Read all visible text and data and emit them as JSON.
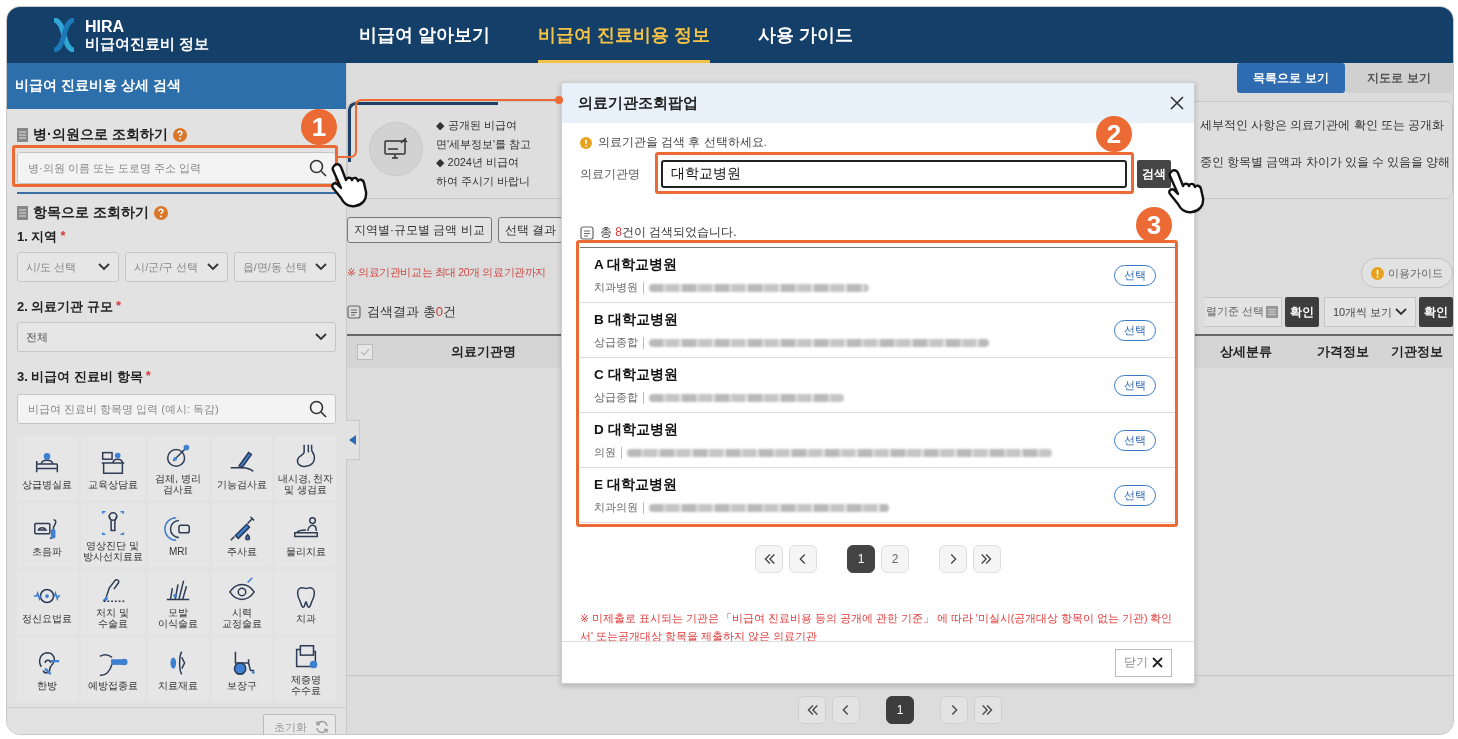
{
  "header": {
    "logo_title": "HIRA",
    "logo_subtitle": "비급여진료비 정보",
    "nav": [
      {
        "label": "비급여 알아보기",
        "selected": false
      },
      {
        "label": "비급여 진료비용 정보",
        "selected": true
      },
      {
        "label": "사용 가이드",
        "selected": false
      }
    ]
  },
  "sidebar": {
    "title": "비급여 진료비용 상세 검색",
    "hospital_search": {
      "heading": "병·의원으로 조회하기",
      "placeholder": "병·의원 이름 또는 도로명 주소 입력"
    },
    "item_search": {
      "heading": "항목으로 조회하기",
      "region": {
        "label": "1. 지역",
        "required_mark": "*",
        "selects": [
          "시/도 선택",
          "시/군/구 선택",
          "읍/면/동 선택"
        ]
      },
      "scale": {
        "label": "2. 의료기관 규모",
        "required_mark": "*",
        "value": "전체"
      },
      "category": {
        "label": "3. 비급여 진료비 항목",
        "required_mark": "*",
        "placeholder": "비급여 진료비 항목명 입력 (예시: 독감)",
        "items": [
          {
            "label": "상급병실료"
          },
          {
            "label": "교육상담료"
          },
          {
            "label": "검체, 병리 검사료"
          },
          {
            "label": "기능검사료"
          },
          {
            "label": "내시경, 천자 및 생검료"
          },
          {
            "label": "초음파"
          },
          {
            "label": "영상진단 및 방사선치료료"
          },
          {
            "label": "MRI"
          },
          {
            "label": "주사료"
          },
          {
            "label": "물리치료"
          },
          {
            "label": "정신요법료"
          },
          {
            "label": "처치 및 수술료"
          },
          {
            "label": "모발 이식술료"
          },
          {
            "label": "시력 교정술료"
          },
          {
            "label": "치과"
          },
          {
            "label": "한방"
          },
          {
            "label": "예방접종료"
          },
          {
            "label": "치료재료"
          },
          {
            "label": "보장구"
          },
          {
            "label": "제증명 수수료"
          }
        ]
      }
    },
    "reset": "초기화"
  },
  "main": {
    "view_tabs": [
      {
        "label": "목록으로 보기",
        "selected": true
      },
      {
        "label": "지도로 보기",
        "selected": false
      }
    ],
    "notice": {
      "left_lines": [
        "◆ 공개된 비급여",
        "면'세부정보'를 참고",
        "◆ 2024년 비급여",
        "하여 주시기 바랍니"
      ],
      "right_lines": [
        "세부적인 사항은 의료기관에 확인 또는 공개화",
        "중인 항목별 금액과 차이가 있을 수 있음을 양해"
      ]
    },
    "buttons": [
      "지역별·규모별 금액 비교",
      "선택 결과"
    ],
    "compare_note": "※ 의료기관비교는 최대 20개 의료기관까지",
    "guide_button": "이용가이드",
    "result_count": {
      "prefix": "검색결과 총",
      "count": "0",
      "suffix": "건"
    },
    "sort_placeholder": "렬기준 선택",
    "sort_confirm": "확인",
    "page_size": "10개씩 보기",
    "page_size_confirm": "확인",
    "header_checkbox": {
      "checked": false
    },
    "columns": [
      "의료기관명",
      "상세분류",
      "가격정보",
      "기관정보"
    ],
    "pages": [
      {
        "label": "1",
        "selected": true
      }
    ]
  },
  "popup": {
    "title": "의료기관조회팝업",
    "hint": "의료기관을 검색 후 선택하세요.",
    "field_label": "의료기관명",
    "field_value": "대학교병원",
    "search_button": "검색",
    "result_count": {
      "prefix": "총 ",
      "count": "8",
      "suffix": "건이 검색되었습니다."
    },
    "results": [
      {
        "name": "A 대학교병원",
        "type": "치과병원",
        "action": "선택"
      },
      {
        "name": "B 대학교병원",
        "type": "상급종합",
        "action": "선택"
      },
      {
        "name": "C 대학교병원",
        "type": "상급종합",
        "action": "선택"
      },
      {
        "name": "D 대학교병원",
        "type": "의원",
        "action": "선택"
      },
      {
        "name": "E 대학교병원",
        "type": "치과의원",
        "action": "선택"
      }
    ],
    "pages": [
      {
        "label": "1",
        "selected": true
      },
      {
        "label": "2",
        "selected": false
      }
    ],
    "note": "※ 미제출로 표시되는 기관은 「비급여 진료비용 등의 공개에 관한 기준」 에 따라 '미실시(공개대상 항목이 없는 기관) 확인서' 또는공개대상 항목을 제출하지 않은 의료기관",
    "close_button": "닫기"
  },
  "guide_marks": [
    "1",
    "2",
    "3"
  ]
}
